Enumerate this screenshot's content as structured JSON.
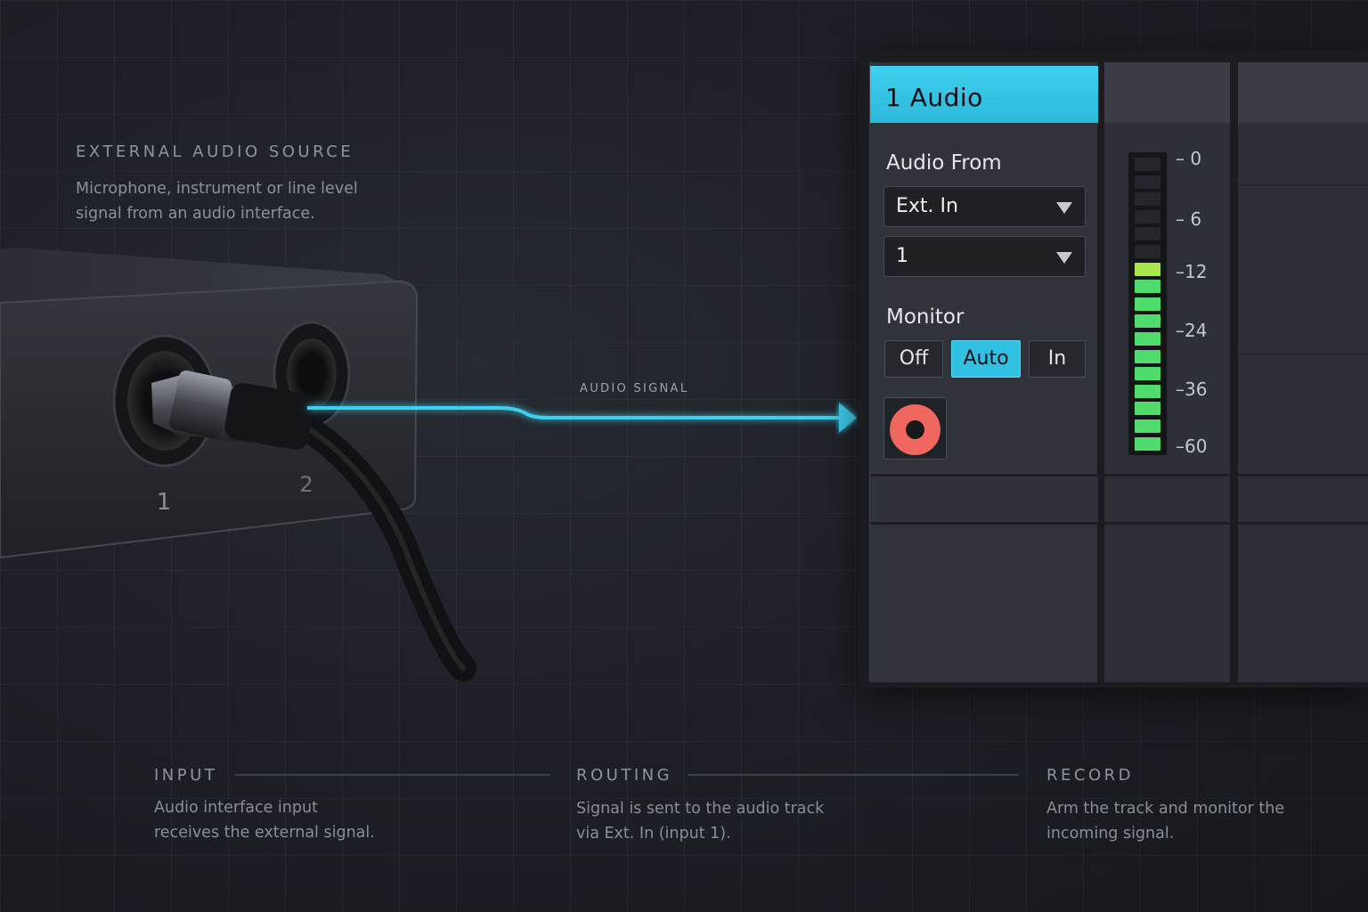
{
  "source": {
    "heading": "EXTERNAL AUDIO SOURCE",
    "description": "Microphone, instrument or line level signal from an audio interface."
  },
  "interface": {
    "input_1_label": "1",
    "input_2_label": "2"
  },
  "signal": {
    "label": "AUDIO SIGNAL",
    "color": "#3ccfee"
  },
  "track": {
    "title": "1  Audio",
    "header_color": "#3fd0ef",
    "audio_from": {
      "label": "Audio From",
      "source_value": "Ext. In",
      "channel_value": "1"
    },
    "monitor": {
      "label": "Monitor",
      "options": [
        "Off",
        "Auto",
        "In"
      ],
      "selected": "Auto"
    },
    "record_arm": {
      "armed": true,
      "color": "#f0675f"
    }
  },
  "meter": {
    "scale_labels": [
      "– 0",
      "– 6",
      "–12",
      "–24",
      "–36",
      "–60"
    ],
    "total_segments": 17,
    "lit_segments": 11,
    "lit_color": "#4fdc6c",
    "peak_color": "#a8e64c"
  },
  "steps": [
    {
      "heading": "INPUT",
      "description": "Audio interface input receives the external signal."
    },
    {
      "heading": "ROUTING",
      "description": "Signal is sent to the audio track via Ext. In (input 1)."
    },
    {
      "heading": "RECORD",
      "description": "Arm the track and monitor the incoming signal."
    }
  ]
}
